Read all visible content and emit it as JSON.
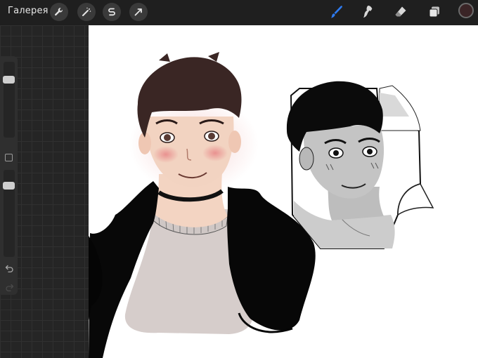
{
  "toolbar": {
    "gallery_label": "Галерея",
    "left_tools": [
      {
        "name": "wrench-icon"
      },
      {
        "name": "magic-wand-icon"
      },
      {
        "name": "selection-icon"
      },
      {
        "name": "move-arrow-icon"
      }
    ],
    "right_tools": [
      {
        "name": "brush-icon",
        "active": true
      },
      {
        "name": "smudge-icon"
      },
      {
        "name": "eraser-icon"
      },
      {
        "name": "layers-icon"
      }
    ],
    "current_color": "#3a2426",
    "active_tool_color": "#2e7bf0"
  },
  "sidebar": {
    "brush_size": 0.21,
    "opacity": 0.15,
    "undo_icon": "undo-icon",
    "redo_icon": "redo-icon"
  },
  "canvas": {
    "background": "#ffffff"
  }
}
